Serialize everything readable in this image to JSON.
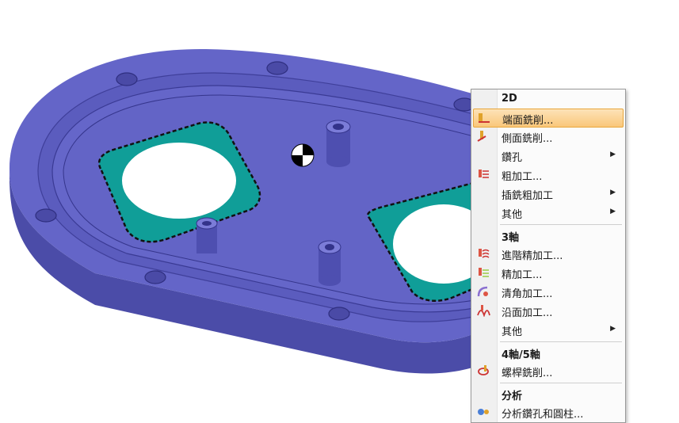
{
  "menu": {
    "section_2d": "2D",
    "face_mill": "端面銑削...",
    "side_mill": "側面銑削...",
    "drill": "鑽孔",
    "rough": "粗加工...",
    "plunge_rough": "插銑粗加工",
    "other_2d": "其他",
    "section_3axis": "3軸",
    "adv_finish": "進階精加工...",
    "finish": "精加工...",
    "corner_clean": "清角加工...",
    "face_along": "沿面加工...",
    "other_3axis": "其他",
    "section_45axis": "4軸/5軸",
    "screw_mill": "螺桿銑削...",
    "section_analysis": "分析",
    "analyze_holes": "分析鑽孔和圓柱..."
  },
  "colors": {
    "part": "#6465c8",
    "part_dark": "#3f3f9a",
    "pocket": "#109e98",
    "highlight": "#f9c77a"
  },
  "icons": [
    "face-mill-icon",
    "side-mill-icon",
    "rough-icon",
    "adv-finish-icon",
    "finish-icon",
    "corner-clean-icon",
    "face-along-icon",
    "screw-mill-icon",
    "analyze-holes-icon",
    "submenu-arrow-icon",
    "origin-marker-icon"
  ]
}
